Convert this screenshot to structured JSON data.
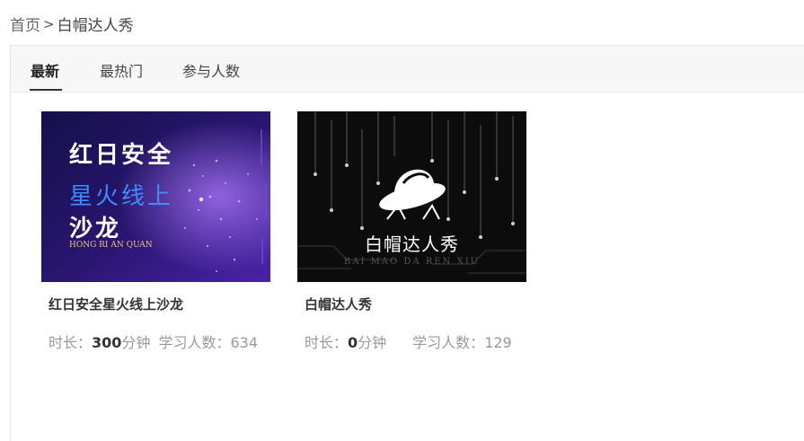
{
  "breadcrumb": {
    "home": "首页",
    "separator": ">",
    "current": "白帽达人秀"
  },
  "tabs": [
    {
      "label": "最新",
      "active": true
    },
    {
      "label": "最热门",
      "active": false
    },
    {
      "label": "参与人数",
      "active": false
    }
  ],
  "courses": [
    {
      "title": "红日安全星火线上沙龙",
      "duration_label": "时长：",
      "duration_value": "300",
      "duration_unit": "分钟",
      "learners_label": "学习人数：",
      "learners_value": "634",
      "thumb": {
        "line1": "红日安全",
        "line2": "星火线上",
        "line3": "沙龙",
        "sub": "HONG RI AN QUAN",
        "colors": {
          "bg_dark": "#16104a",
          "bg_purple": "#3b1a8a",
          "accent_blue": "#3d8bff"
        }
      }
    },
    {
      "title": "白帽达人秀",
      "duration_label": "时长：",
      "duration_value": "0",
      "duration_unit": "分钟",
      "learners_label": "学习人数：",
      "learners_value": "129",
      "thumb": {
        "line1": "白帽达人秀",
        "sub": "BAI MAO DA REN XIU",
        "colors": {
          "bg": "#0c0c0c"
        }
      }
    }
  ]
}
